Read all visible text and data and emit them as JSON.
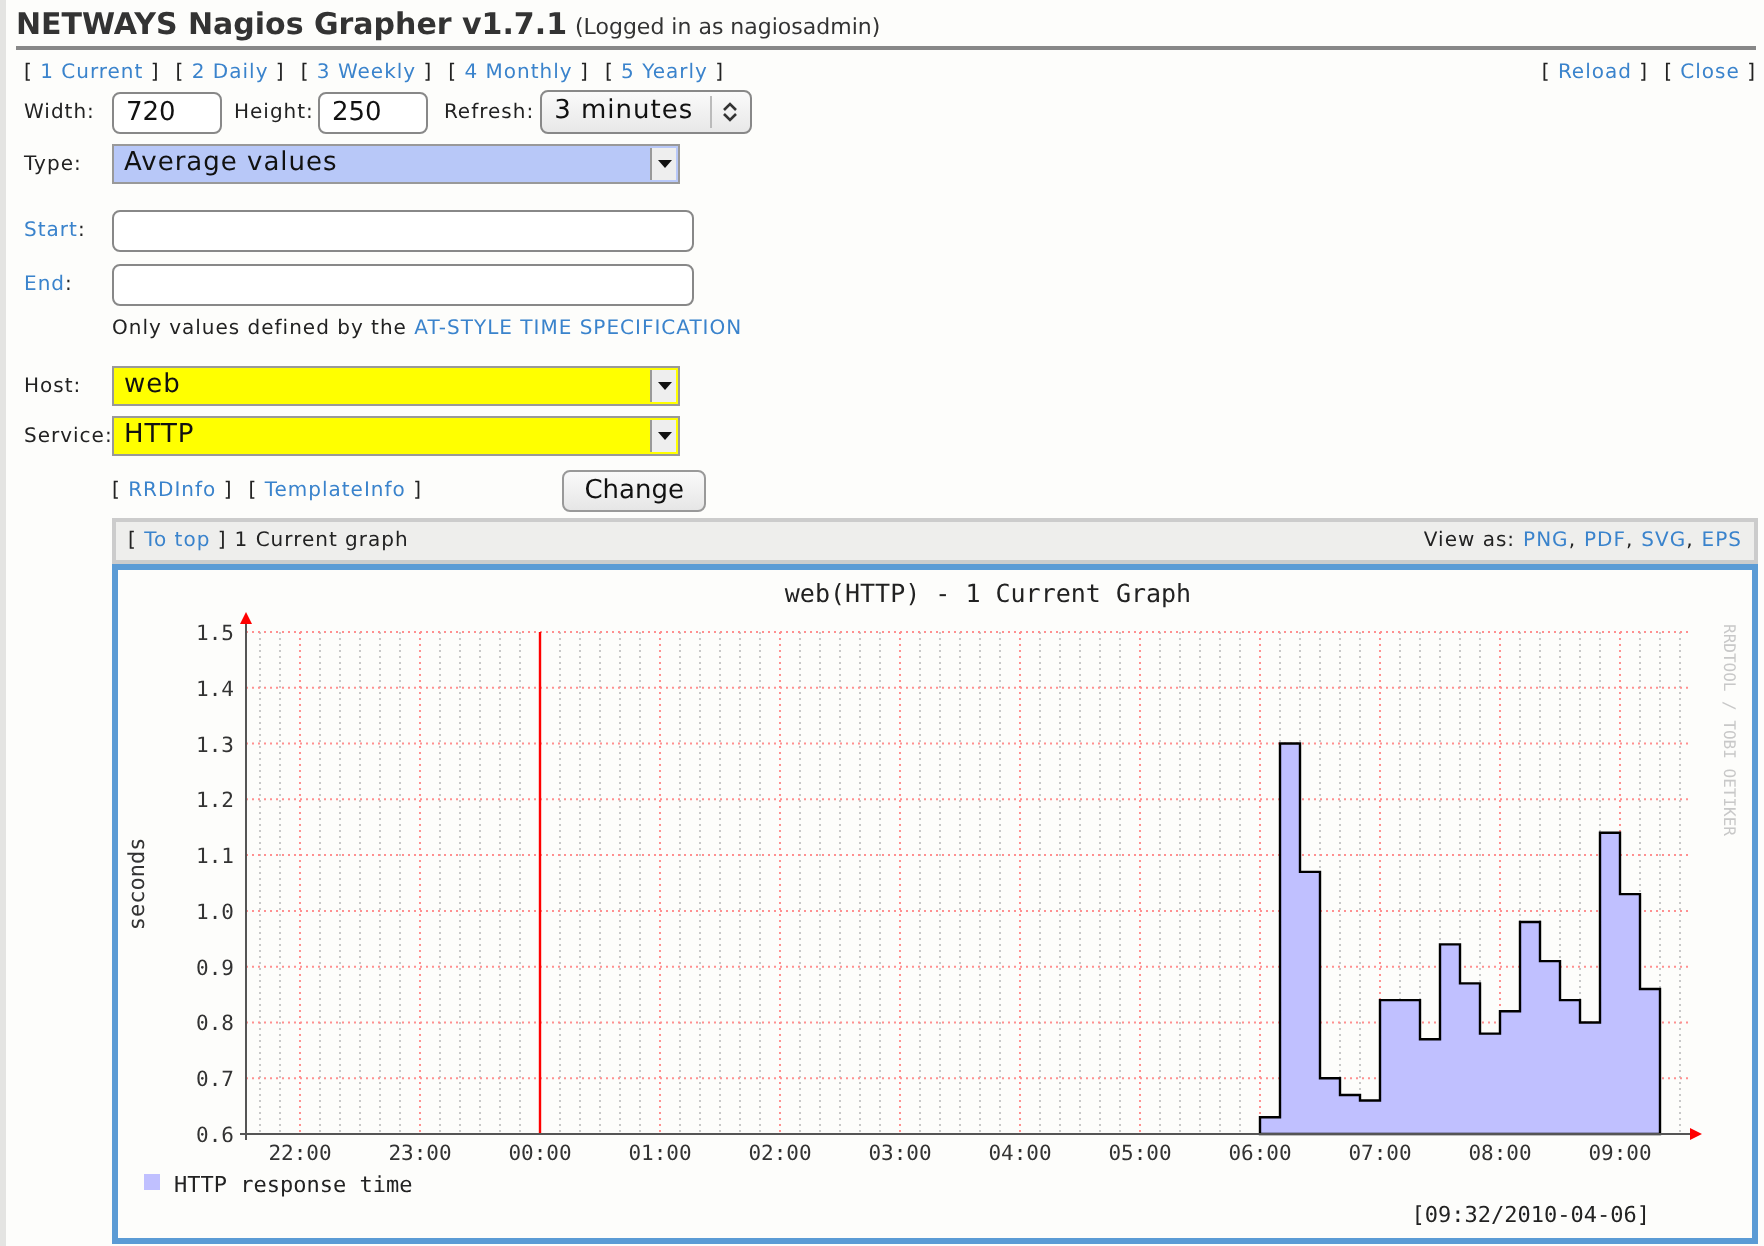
{
  "header": {
    "title": "NETWAYS Nagios Grapher v1.7.1",
    "login": "(Logged in as nagiosadmin)"
  },
  "periods": [
    {
      "open": "[",
      "label": "1 Current",
      "close": "]"
    },
    {
      "open": "[",
      "label": "2 Daily",
      "close": "]"
    },
    {
      "open": "[",
      "label": "3 Weekly",
      "close": "]"
    },
    {
      "open": "[",
      "label": "4 Monthly",
      "close": "]"
    },
    {
      "open": "[",
      "label": "5 Yearly",
      "close": "]"
    }
  ],
  "actions": [
    {
      "open": "[",
      "label": "Reload",
      "close": "]"
    },
    {
      "open": "[",
      "label": "Close",
      "close": "]"
    }
  ],
  "form": {
    "width": {
      "label": "Width:",
      "value": "720"
    },
    "height": {
      "label": "Height:",
      "value": "250"
    },
    "refresh": {
      "label": "Refresh:",
      "value": "3 minutes"
    },
    "type": {
      "label": "Type:",
      "value": "Average values"
    },
    "start": {
      "label": "Start",
      "suffix": ":"
    },
    "end": {
      "label": "End",
      "suffix": ":"
    },
    "note": {
      "text": "Only values defined by the",
      "link": "AT-STYLE TIME SPECIFICATION"
    },
    "host": {
      "label": "Host:",
      "value": "web"
    },
    "service": {
      "label": "Service:",
      "value": "HTTP"
    },
    "links": [
      {
        "open": "[",
        "label": "RRDInfo",
        "close": "]"
      },
      {
        "open": "[",
        "label": "TemplateInfo",
        "close": "]"
      }
    ],
    "submit": "Change"
  },
  "graph": {
    "to_top": {
      "open": "[",
      "label": "To top",
      "close": "]"
    },
    "caption": "1 Current graph",
    "view_as": "View as:",
    "formats": [
      {
        "label": "PNG",
        "sep": ","
      },
      {
        "label": "PDF",
        "sep": ","
      },
      {
        "label": "SVG",
        "sep": ","
      },
      {
        "label": "EPS"
      }
    ],
    "credit": "RRDTOOL / TOBI OETIKER",
    "timestamp": "[09:32/2010-04-06]",
    "chart_data": {
      "type": "area",
      "title": "web(HTTP) - 1 Current Graph",
      "ylabel": "seconds",
      "x": [
        "2010-04-06 06:00",
        "2010-04-06 06:10",
        "2010-04-06 06:20",
        "2010-04-06 06:30",
        "2010-04-06 06:40",
        "2010-04-06 06:50",
        "2010-04-06 07:00",
        "2010-04-06 07:10",
        "2010-04-06 07:20",
        "2010-04-06 07:30",
        "2010-04-06 07:40",
        "2010-04-06 07:50",
        "2010-04-06 08:00",
        "2010-04-06 08:10",
        "2010-04-06 08:20",
        "2010-04-06 08:30",
        "2010-04-06 08:40",
        "2010-04-06 08:50",
        "2010-04-06 09:00",
        "2010-04-06 09:10",
        "2010-04-06 09:20"
      ],
      "series": [
        {
          "name": "HTTP response time",
          "color": "#c0c0ff",
          "values": [
            0.63,
            1.3,
            1.07,
            0.7,
            0.67,
            0.66,
            0.84,
            0.84,
            0.77,
            0.94,
            0.87,
            0.78,
            0.82,
            0.98,
            0.91,
            0.84,
            0.8,
            1.14,
            1.03,
            0.86,
            0.86
          ]
        }
      ],
      "xlim": [
        "2010-04-05 21:33",
        "2010-04-06 09:35"
      ],
      "ylim": [
        0.6,
        1.5
      ],
      "grid": true,
      "xticks": [
        {
          "value": "2010-04-05 22:00",
          "label": "22:00"
        },
        {
          "value": "2010-04-05 23:00",
          "label": "23:00"
        },
        {
          "value": "2010-04-06 00:00",
          "label": "00:00"
        },
        {
          "value": "2010-04-06 01:00",
          "label": "01:00"
        },
        {
          "value": "2010-04-06 02:00",
          "label": "02:00"
        },
        {
          "value": "2010-04-06 03:00",
          "label": "03:00"
        },
        {
          "value": "2010-04-06 04:00",
          "label": "04:00"
        },
        {
          "value": "2010-04-06 05:00",
          "label": "05:00"
        },
        {
          "value": "2010-04-06 06:00",
          "label": "06:00"
        },
        {
          "value": "2010-04-06 07:00",
          "label": "07:00"
        },
        {
          "value": "2010-04-06 08:00",
          "label": "08:00"
        },
        {
          "value": "2010-04-06 09:00",
          "label": "09:00"
        }
      ],
      "yticks": [
        {
          "value": 0.6,
          "label": "0.6"
        },
        {
          "value": 0.7,
          "label": "0.7"
        },
        {
          "value": 0.8,
          "label": "0.8"
        },
        {
          "value": 0.9,
          "label": "0.9"
        },
        {
          "value": 1.0,
          "label": "1.0"
        },
        {
          "value": 1.1,
          "label": "1.1"
        },
        {
          "value": 1.2,
          "label": "1.2"
        },
        {
          "value": 1.3,
          "label": "1.3"
        },
        {
          "value": 1.4,
          "label": "1.4"
        },
        {
          "value": 1.5,
          "label": "1.5"
        }
      ],
      "ref_lines": [
        {
          "axis": "x",
          "value": "2010-04-06 00:00",
          "color": "#ff0000"
        }
      ]
    }
  }
}
